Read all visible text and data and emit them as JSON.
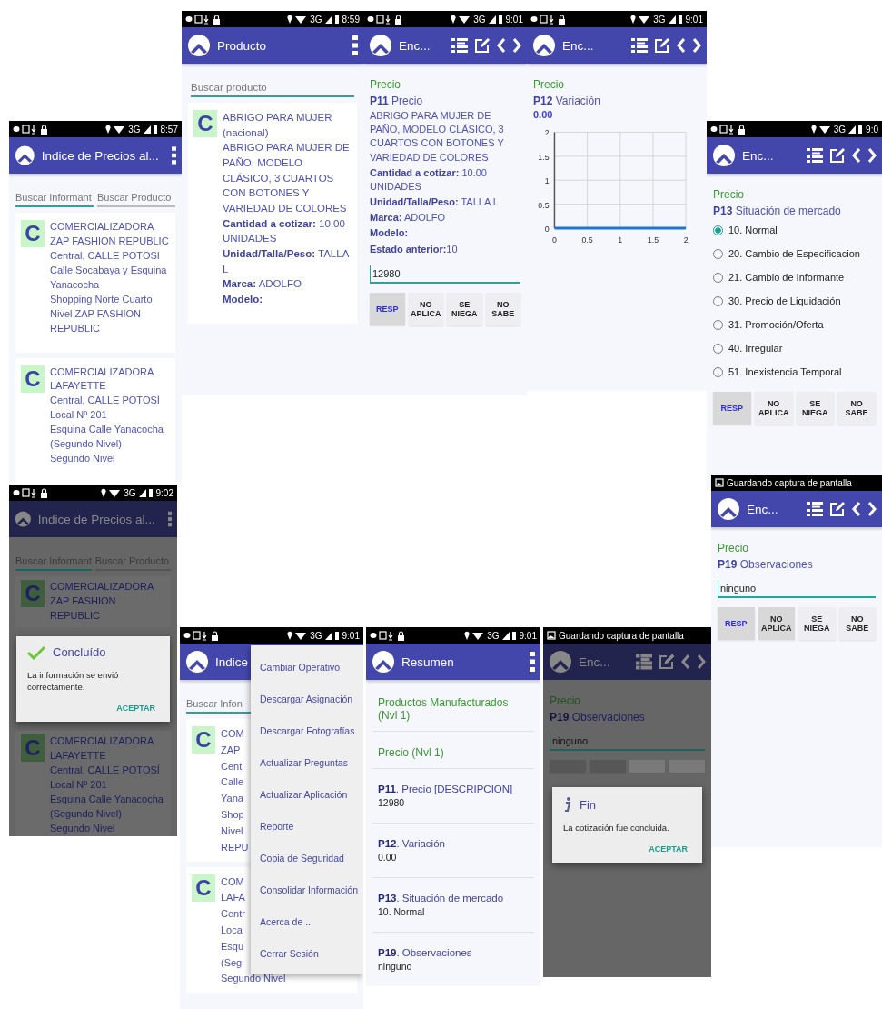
{
  "screens": [
    {
      "status": {
        "time": "8:57",
        "network": "3G"
      },
      "header": {
        "kind": "menu",
        "title": "Indice de Precios al..."
      },
      "body": {
        "kind": "informants",
        "search": [
          {
            "placeholder": "Buscar Informant",
            "selected": true
          },
          {
            "placeholder": "Buscar Producto",
            "selected": false
          }
        ],
        "items": [
          {
            "letter": "C",
            "lines": [
              "COMERCIALIZADORA ZAP FASHION REPUBLIC",
              "Central, CALLE POTOSI",
              "Calle Socabaya y Esquina Yanacocha",
              "Shopping Norte Cuarto Nivel ZAP FASHION REPUBLIC"
            ]
          },
          {
            "letter": "C",
            "lines": [
              "COMERCIALIZADORA LAFAYETTE",
              "Central, CALLE POTOSÍ",
              "Local Nº 201",
              "Esquina Calle Yanacocha",
              "(Segundo Nivel)",
              "Segundo Nivel"
            ]
          }
        ]
      }
    },
    {
      "status": {
        "time": "8:59",
        "network": "3G"
      },
      "header": {
        "kind": "menu",
        "title": "Producto"
      },
      "body": {
        "kind": "products",
        "search": {
          "placeholder": "Buscar producto"
        },
        "items": [
          {
            "letter": "C",
            "name": "ABRIGO PARA MUJER (nacional)",
            "description": "ABRIGO PARA MUJER DE PAÑO, MODELO CLÁSICO, 3 CUARTOS CON BOTONES Y VARIEDAD DE COLORES",
            "fields": [
              {
                "label": "Cantidad a cotizar:",
                "value": " 10.00 UNIDADES"
              },
              {
                "label": "Unidad/Talla/Peso:",
                "value": " TALLA L"
              },
              {
                "label": "Marca:",
                "value": " ADOLFO"
              },
              {
                "label": "Modelo:"
              }
            ]
          }
        ]
      }
    },
    {
      "status": {
        "time": "9:01",
        "network": "3G"
      },
      "header": {
        "kind": "survey",
        "title": "Enc..."
      },
      "body": {
        "kind": "question",
        "section": "Precio",
        "question": "**P11** Precio",
        "description": "ABRIGO PARA MUJER DE PAÑO, MODELO CLÁSICO, 3 CUARTOS CON BOTONES Y VARIEDAD DE COLORES",
        "fields": [
          {
            "label": "Cantidad a cotizar:",
            "value": " 10.00 UNIDADES"
          },
          {
            "label": "Unidad/Talla/Peso:",
            "value": " TALLA L"
          },
          {
            "label": "Marca:",
            "value": " ADOLFO"
          },
          {
            "label": "Modelo:"
          },
          {
            "label": "Estado anterior:",
            "value": "10"
          }
        ],
        "input": {
          "value": "12980"
        },
        "answers": [
          {
            "label": "RESP",
            "selected": true,
            "pressed": true
          },
          {
            "label": "NO APLICA",
            "selected": false,
            "pressed": false
          },
          {
            "label": "SE NIEGA",
            "selected": false,
            "pressed": false
          },
          {
            "label": "NO SABE",
            "selected": false,
            "pressed": false
          }
        ]
      }
    },
    {
      "status": {
        "time": "9:01",
        "network": "3G"
      },
      "header": {
        "kind": "survey",
        "title": "Enc..."
      },
      "body": {
        "kind": "question",
        "section": "Precio",
        "question": "**P12** Variación",
        "value": "0.00",
        "chart_data": {
          "type": "line",
          "x": [
            0,
            2
          ],
          "series": [
            {
              "color": "#1976d2",
              "values": [
                0,
                0
              ]
            }
          ],
          "xlim": [
            0,
            2
          ],
          "ylim": [
            0,
            2
          ],
          "xticks": [
            0,
            0.5,
            1,
            1.5,
            2
          ],
          "yticks": [
            0,
            0.5,
            1,
            1.5,
            2
          ],
          "grid": true
        }
      }
    },
    {
      "status": {
        "time": "9:0",
        "network": "3G"
      },
      "header": {
        "kind": "survey",
        "title": "Enc..."
      },
      "body": {
        "kind": "question",
        "section": "Precio",
        "question": "**P13** Situación de mercado",
        "options": [
          {
            "label": "10. Normal",
            "selected": true
          },
          {
            "label": "20. Cambio de Especificacion",
            "selected": false
          },
          {
            "label": "21. Cambio de Informante",
            "selected": false
          },
          {
            "label": "30. Precio de Liquidación",
            "selected": false
          },
          {
            "label": "31. Promoción/Oferta",
            "selected": false
          },
          {
            "label": "40. Irregular",
            "selected": false
          },
          {
            "label": "51. Inexistencia Temporal",
            "selected": false
          }
        ],
        "answers": [
          {
            "label": "RESP",
            "selected": true,
            "pressed": true
          },
          {
            "label": "NO APLICA",
            "selected": false,
            "pressed": false
          },
          {
            "label": "SE NIEGA",
            "selected": false,
            "pressed": false
          },
          {
            "label": "NO SABE",
            "selected": false,
            "pressed": false
          }
        ]
      }
    },
    {
      "status": {
        "time": "9:02",
        "network": "3G"
      },
      "header": {
        "kind": "menu",
        "title": "Indice de Precios al..."
      },
      "body": {
        "kind": "informants",
        "search": [
          {
            "placeholder": "Buscar Informant",
            "selected": true
          },
          {
            "placeholder": "Buscar Producto",
            "selected": false
          }
        ],
        "items": [
          {
            "letter": "C",
            "lines": [
              "COMERCIALIZADORA ZAP FASHION REPUBLIC"
            ]
          },
          {
            "letter": "C",
            "lines": [
              "COMERCIALIZADORA LAFAYETTE",
              "Central, CALLE POTOSÍ",
              "Local Nº 201",
              "Esquina Calle Yanacocha",
              "(Segundo Nivel)",
              "Segundo Nivel"
            ]
          }
        ]
      },
      "overlay": {
        "kind": "dialog",
        "title": "Concluído",
        "message": "La información se envió correctamente.",
        "button": "ACEPTAR"
      }
    },
    {
      "status": {
        "time": "9:01",
        "network": "3G"
      },
      "header": {
        "kind": "plain",
        "title": "Indice"
      },
      "body": {
        "kind": "informants",
        "search": [
          {
            "placeholder": "Buscar Infon",
            "selected": true
          }
        ],
        "items": [
          {
            "letter": "C",
            "lines": [
              "COM",
              "ZAP",
              "Cent",
              "Calle",
              "Yana",
              "Shop",
              "Nivel",
              "REPU"
            ]
          },
          {
            "letter": "C",
            "lines": [
              "COM",
              "LAFA",
              "Centr",
              "Loca",
              "Esqu",
              "(Seg",
              "Segundo Nivel"
            ]
          }
        ]
      },
      "overlay": {
        "kind": "menu",
        "items": [
          "Cambiar Operativo",
          "Descargar Asignación",
          "Descargar Fotografías",
          "Actualizar Preguntas",
          "Actualizar Aplicación",
          "Reporte",
          "Copia de Seguridad",
          "Consolidar Información",
          "Acerca de ...",
          "Cerrar Sesión"
        ]
      }
    },
    {
      "status": {
        "time": "9:01",
        "network": "3G"
      },
      "header": {
        "kind": "menu",
        "title": "Resumen"
      },
      "body": {
        "kind": "summary",
        "sections": [
          "Productos Manufacturados (Nvl 1)",
          "Precio (Nvl 1)"
        ],
        "entries": [
          {
            "question": "**P11**. Precio [DESCRIPCION]",
            "answer": "12980"
          },
          {
            "question": "**P12**. Variación",
            "answer": "0.00"
          },
          {
            "question": "**P13**. Situación de mercado",
            "answer": "10. Normal"
          },
          {
            "question": "**P19**. Observaciones",
            "answer": "ninguno"
          }
        ]
      }
    },
    {
      "status": {
        "notification": "Guardando captura de pantalla"
      },
      "header": {
        "kind": "survey",
        "title": "Enc..."
      },
      "body": {
        "kind": "question",
        "section": "Precio",
        "question": "**P19** Observaciones",
        "input": {
          "value": "ninguno"
        },
        "answers": [
          {
            "pressed": true
          },
          {
            "pressed": true
          },
          {
            "pressed": false
          },
          {
            "pressed": false
          }
        ]
      },
      "overlay": {
        "kind": "dialog",
        "title": "Fin",
        "message": "La cotización fue concluida.",
        "button": "ACEPTAR"
      }
    },
    {
      "status": {
        "notification": "Guardando captura de pantalla"
      },
      "header": {
        "kind": "survey",
        "title": "Enc..."
      },
      "body": {
        "kind": "question",
        "section": "Precio",
        "question": "**P19** Observaciones",
        "input": {
          "value": "ninguno"
        },
        "answers": [
          {
            "label": "RESP",
            "selected": true,
            "pressed": true
          },
          {
            "label": "NO APLICA",
            "selected": false,
            "pressed": true
          },
          {
            "label": "SE NIEGA",
            "selected": false,
            "pressed": false
          },
          {
            "label": "NO SABE",
            "selected": false,
            "pressed": false
          }
        ]
      }
    }
  ]
}
